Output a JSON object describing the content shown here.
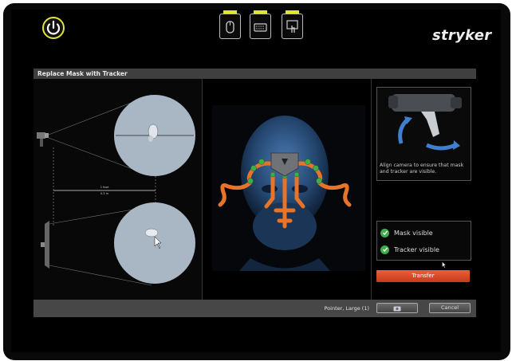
{
  "header": {
    "brand": "stryker",
    "power_icon": "power-icon",
    "toolbar_icons": [
      "mouse-icon",
      "keyboard-icon",
      "touch-icon"
    ],
    "indicator_color": "#e2e23a"
  },
  "dialog": {
    "title": "Replace Mask with Tracker",
    "diagram": {
      "distance_line1": "1 foot",
      "distance_line2": "0.3 m"
    },
    "instruction": "Align camera to ensure that mask and tracker are visible.",
    "status": [
      {
        "label": "Mask visible",
        "ok": true
      },
      {
        "label": "Tracker visible",
        "ok": true
      }
    ],
    "transfer_label": "Transfer",
    "footer": {
      "pointer_label": "Pointer, Large (1)",
      "cancel_label": "Cancel"
    }
  },
  "colors": {
    "accent": "#e0582e",
    "ok": "#3fae4a",
    "tracker_orange": "#e8742a",
    "disk": "#a9b7c4"
  }
}
